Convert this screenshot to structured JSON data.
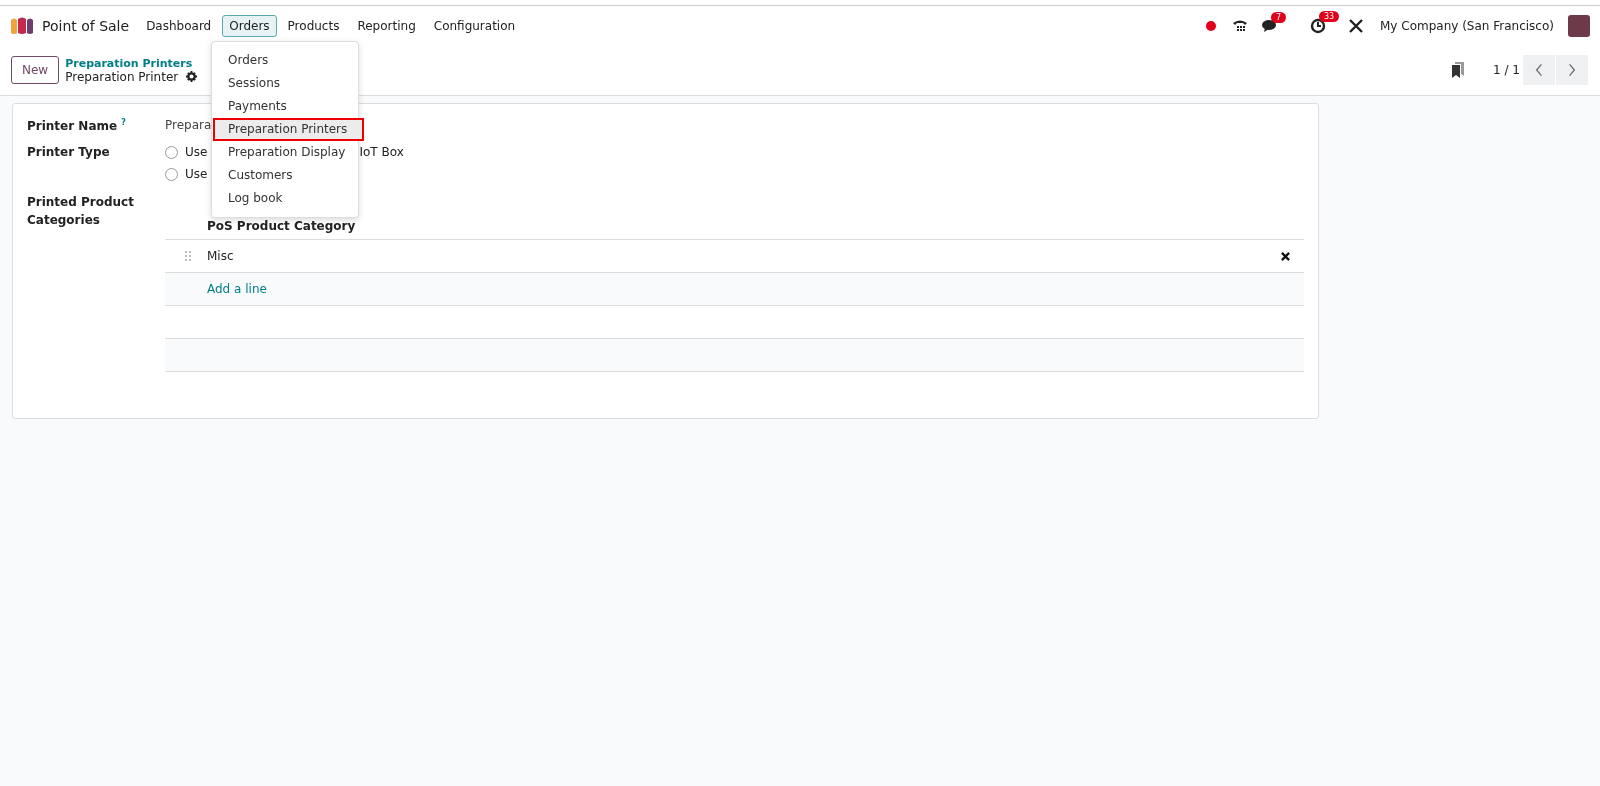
{
  "navbar": {
    "app_name": "Point of Sale",
    "menu": [
      {
        "label": "Dashboard",
        "selected": false
      },
      {
        "label": "Orders",
        "selected": true
      },
      {
        "label": "Products",
        "selected": false
      },
      {
        "label": "Reporting",
        "selected": false
      },
      {
        "label": "Configuration",
        "selected": false
      }
    ],
    "chat_badge": "7",
    "activity_badge": "33",
    "company": "My Company (San Francisco)"
  },
  "orders_menu": {
    "items": [
      {
        "label": "Orders",
        "selected": false
      },
      {
        "label": "Sessions",
        "selected": false
      },
      {
        "label": "Payments",
        "selected": false
      },
      {
        "label": "Preparation Printers",
        "selected": true
      },
      {
        "label": "Preparation Display",
        "selected": false
      },
      {
        "label": "Customers",
        "selected": false
      },
      {
        "label": "Log book",
        "selected": false
      }
    ]
  },
  "control_panel": {
    "new_button": "New",
    "breadcrumb": "Preparation Printers",
    "record_title": "Preparation Printer",
    "pager": "1 / 1"
  },
  "form": {
    "printer_name_label": "Printer Name",
    "help_mark": "?",
    "printer_name_value": "Prepara",
    "printer_type_label": "Printer Type",
    "printer_type_options": [
      {
        "label": "Use",
        "suffix": "IoT Box",
        "selected": false
      },
      {
        "label": "Use",
        "selected": false
      }
    ],
    "categories_label": "Printed Product Categories",
    "categories_column": "PoS Product Category",
    "categories": [
      "Misc"
    ],
    "add_line": "Add a line"
  }
}
